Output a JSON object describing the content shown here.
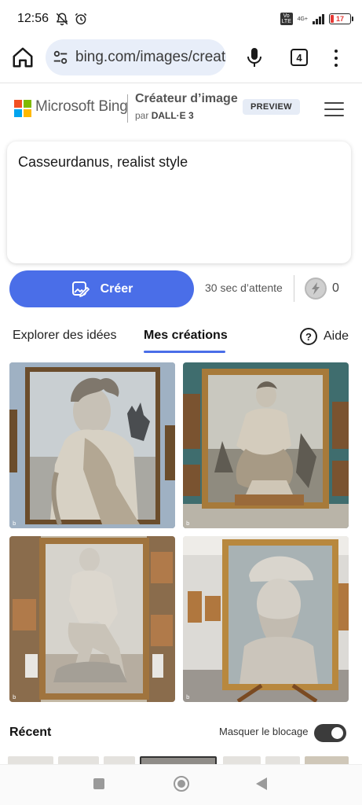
{
  "status_bar": {
    "time": "12:56",
    "volte": "Vo LTE",
    "network": "4G+",
    "battery": "17",
    "battery_color": "#e53935",
    "icons": [
      "notifications-off-icon",
      "alarm-icon",
      "signal-icon",
      "battery-icon"
    ]
  },
  "browser": {
    "url": "bing.com/images/create",
    "tab_count": "4",
    "url_bar_color": "#e8eef9"
  },
  "header": {
    "brand": "Microsoft Bing",
    "title": "Créateur d’image",
    "subtitle_prefix": "par",
    "subtitle_model": "DALL·E 3",
    "badge": "PREVIEW"
  },
  "prompt": {
    "text": "Casseurdanus, realist style"
  },
  "create": {
    "label": "Créer",
    "wait": "30 sec d’attente",
    "boost_count": "0",
    "accent": "#4a6ee8"
  },
  "tabs": {
    "explore": "Explorer des idées",
    "mine": "Mes créations",
    "help": "Aide",
    "active": "mine"
  },
  "images": [
    {
      "name": "generated-image-1",
      "watermark": "b"
    },
    {
      "name": "generated-image-2",
      "watermark": "b"
    },
    {
      "name": "generated-image-3",
      "watermark": "b"
    },
    {
      "name": "generated-image-4",
      "watermark": "b"
    }
  ],
  "recent": {
    "title": "Récent",
    "mask_label": "Masquer le blocage",
    "mask_toggle": "on"
  }
}
